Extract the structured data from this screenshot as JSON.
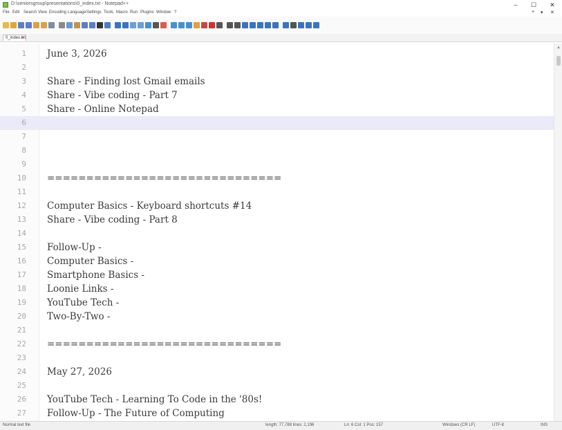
{
  "window": {
    "title": "D:\\seniorsgroup\\presentations\\0_index.txt - Notepad++",
    "minimize": "–",
    "maximize": "☐",
    "close": "✕"
  },
  "menu": {
    "items": [
      "File",
      "Edit",
      "Search",
      "View",
      "Encoding",
      "Language",
      "Settings",
      "Tools",
      "Macro",
      "Run",
      "Plugins",
      "Window",
      "?"
    ],
    "right": [
      "+",
      "▾",
      "✕"
    ]
  },
  "tab": {
    "label": "0_index.txt",
    "close": "✕"
  },
  "editor": {
    "current_line": 6,
    "lines": [
      "June 3, 2026",
      "",
      "Share - Finding lost Gmail emails",
      "Share - Vibe coding - Part 7",
      "Share - Online Notepad",
      "",
      "",
      "",
      "",
      "==============================",
      "",
      "Computer Basics - Keyboard shortcuts #14",
      "Share - Vibe coding - Part 8",
      "",
      "Follow-Up -",
      "Computer Basics -",
      "Smartphone Basics -",
      "Loonie Links -",
      "YouTube Tech -",
      "Two-By-Two -",
      "",
      "==============================",
      "",
      "May 27, 2026",
      "",
      "YouTube Tech - Learning To Code in the '80s!",
      "Follow-Up - The Future of Computing"
    ]
  },
  "status": {
    "file_type": "Normal text file",
    "length": "length: 77,788   lines: 2,196",
    "position": "Ln: 6   Col: 1   Pos: 157",
    "eol": "Windows (CR LF)",
    "encoding": "UTF-8",
    "mode": "INS"
  },
  "toolbar_icons": [
    {
      "name": "new-file-icon",
      "color": "#e8b84a"
    },
    {
      "name": "open-file-icon",
      "color": "#e0a53a"
    },
    {
      "name": "save-icon",
      "color": "#5a7fc4"
    },
    {
      "name": "save-all-icon",
      "color": "#5a7fc4"
    },
    {
      "name": "close-icon",
      "color": "#d9a24a"
    },
    {
      "name": "close-all-icon",
      "color": "#d9a24a"
    },
    {
      "name": "print-icon",
      "color": "#7b8fa8"
    },
    {
      "name": "cut-icon",
      "color": "#8a8a8a"
    },
    {
      "name": "copy-icon",
      "color": "#6a9ad0"
    },
    {
      "name": "paste-icon",
      "color": "#c4964a"
    },
    {
      "name": "undo-icon",
      "color": "#5a7fc4"
    },
    {
      "name": "redo-icon",
      "color": "#5a7fc4"
    },
    {
      "name": "find-icon",
      "color": "#333333"
    },
    {
      "name": "replace-icon",
      "color": "#4a7fc4"
    },
    {
      "name": "zoom-in-icon",
      "color": "#3a74c0"
    },
    {
      "name": "zoom-out-icon",
      "color": "#3a74c0"
    },
    {
      "name": "sync-v-icon",
      "color": "#6aa0d8"
    },
    {
      "name": "sync-h-icon",
      "color": "#6aa0d8"
    },
    {
      "name": "wrap-icon",
      "color": "#4a90d0"
    },
    {
      "name": "all-chars-icon",
      "color": "#555555"
    },
    {
      "name": "indent-guide-icon",
      "color": "#e05a4a"
    },
    {
      "name": "udl-icon",
      "color": "#4a90d0"
    },
    {
      "name": "doc-map-icon",
      "color": "#4a90d0"
    },
    {
      "name": "func-list-icon",
      "color": "#4a90d0"
    },
    {
      "name": "folder-workspace-icon",
      "color": "#e0a040"
    },
    {
      "name": "monitor-icon",
      "color": "#c04a4a"
    },
    {
      "name": "record-macro-icon",
      "color": "#d03030"
    },
    {
      "name": "stop-macro-icon",
      "color": "#555555"
    },
    {
      "name": "play-macro-icon",
      "color": "#555555"
    },
    {
      "name": "play-multi-icon",
      "color": "#555555"
    },
    {
      "name": "save-macro-icon",
      "color": "#3a74c0"
    },
    {
      "name": "spell-check-icon",
      "color": "#3a74c0"
    },
    {
      "name": "compare-icon",
      "color": "#3a74c0"
    },
    {
      "name": "plugin-a-icon",
      "color": "#3a74c0"
    },
    {
      "name": "plugin-b-icon",
      "color": "#3a74c0"
    },
    {
      "name": "plugin-c-icon",
      "color": "#3a74c0"
    },
    {
      "name": "plugin-d-icon",
      "color": "#555555"
    },
    {
      "name": "plugin-e-icon",
      "color": "#3a74c0"
    },
    {
      "name": "plugin-f-icon",
      "color": "#3a74c0"
    },
    {
      "name": "plugin-g-icon",
      "color": "#3a74c0"
    }
  ]
}
